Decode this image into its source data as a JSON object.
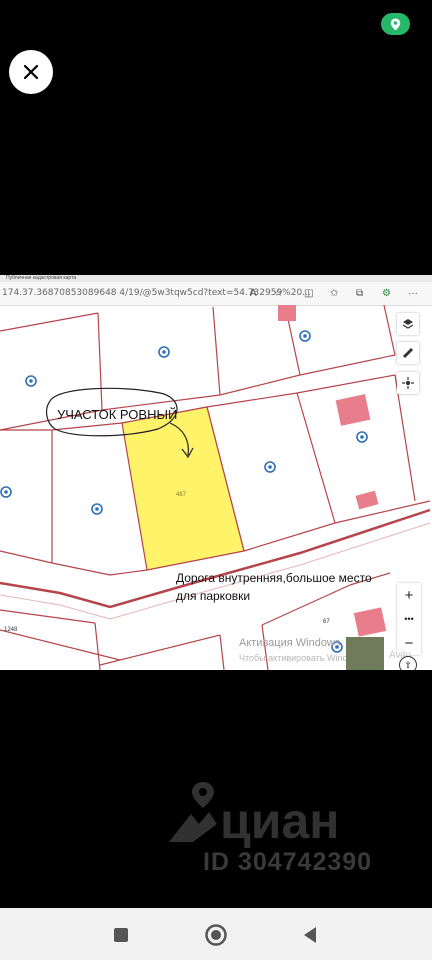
{
  "browser": {
    "tab_title": "Публичная кадастровая карта",
    "url": "174.37.36870853089648 4/19/@5w3tqw5cd?text=54.732959%20...",
    "toolbar_icons": [
      "reader-icon",
      "favorite-icon",
      "split-icon",
      "favorites-list-icon",
      "collections-icon",
      "extensions-icon"
    ]
  },
  "map": {
    "callout_text": "УЧАСТОК РОВНЫЙ",
    "road_caption_line1": "Дорога внутренняя,большое место",
    "road_caption_line2": "для парковки",
    "plot_number": "487",
    "number_left": "1248",
    "number_bottom": "67",
    "highlight_color": "#fff36a",
    "boundary_color": "#b5454b",
    "building_color": "#e87e8b",
    "controls": [
      "layers-icon",
      "ruler-icon",
      "locate-icon"
    ],
    "zoom_in": "+",
    "zoom_dots": "•••",
    "zoom_out": "−",
    "windows_watermark_line1": "Активация Windows",
    "windows_watermark_line2": "Чтобы активировать Windows",
    "avito_watermark": "Avito"
  },
  "watermark": {
    "brand": "циан",
    "listing_id": "ID 304742390"
  },
  "accent_color": "#27b768"
}
